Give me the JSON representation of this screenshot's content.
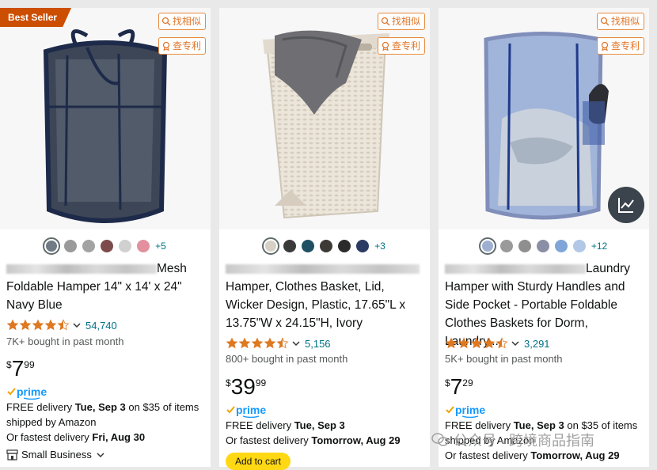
{
  "tools": {
    "find_similar": "找相似",
    "check_patent": "查专利"
  },
  "products": [
    {
      "badge": "Best Seller",
      "title_line1": "Mesh",
      "title_rest": "Foldable Hamper 14\" x 14' x 24\" Navy Blue",
      "swatch_colors": [
        "#707b86",
        "#9a9a9a",
        "#a3a3a3",
        "#7d4b4b",
        "#d0d0d0",
        "#e2909e"
      ],
      "more_colors": "+5",
      "rating": 4.5,
      "rating_count": "54,740",
      "bought": "7K+ bought in past month",
      "price_symbol": "$",
      "price_whole": "7",
      "price_fraction": "99",
      "delivery_prefix": "FREE delivery ",
      "delivery_date": "Tue, Sep 3",
      "delivery_suffix": " on $35 of items",
      "shipped_by": "shipped by Amazon",
      "fastest_prefix": "Or fastest delivery ",
      "fastest_date": "Fri, Aug 30",
      "small_business": "Small Business"
    },
    {
      "title_rest": "Hamper, Clothes Basket, Lid, Wicker Design, Plastic, 17.65\"L x 13.75\"W x 24.15\"H, Ivory",
      "swatch_colors": [
        "#d6d0c6",
        "#3a3a3a",
        "#1f4f63",
        "#3d3a36",
        "#2b2b2b",
        "#2b3a63"
      ],
      "more_colors": "+3",
      "rating": 4.5,
      "rating_count": "5,156",
      "bought": "800+ bought in past month",
      "price_symbol": "$",
      "price_whole": "39",
      "price_fraction": "99",
      "delivery_prefix": "FREE delivery ",
      "delivery_date": "Tue, Sep 3",
      "fastest_prefix": "Or fastest delivery ",
      "fastest_date": "Tomorrow, Aug 29",
      "add_to_cart": "Add to cart"
    },
    {
      "title_line1": "Laundry",
      "title_rest": "Hamper with Sturdy Handles and Side Pocket - Portable Foldable Clothes Baskets for Dorm, Laundry...",
      "swatch_colors": [
        "#9eb0d2",
        "#9a9a9a",
        "#8f8f8f",
        "#8a8fa6",
        "#7fa6d6",
        "#b3c8e6"
      ],
      "more_colors": "+12",
      "rating": 4.5,
      "rating_count": "3,291",
      "bought": "5K+ bought in past month",
      "price_symbol": "$",
      "price_whole": "7",
      "price_fraction": "29",
      "delivery_prefix": "FREE delivery ",
      "delivery_date": "Tue, Sep 3",
      "delivery_suffix": " on $35 of items",
      "shipped_by": "shipped by Amazon",
      "fastest_prefix": "Or fastest delivery ",
      "fastest_date": "Tomorrow, Aug 29"
    }
  ],
  "watermark": "公众号 · 跨境商品指南",
  "colors": {
    "link": "#007185",
    "star": "#de7921",
    "badge": "#cc4e00",
    "prime": "#1399ff",
    "cart": "#ffd814"
  }
}
